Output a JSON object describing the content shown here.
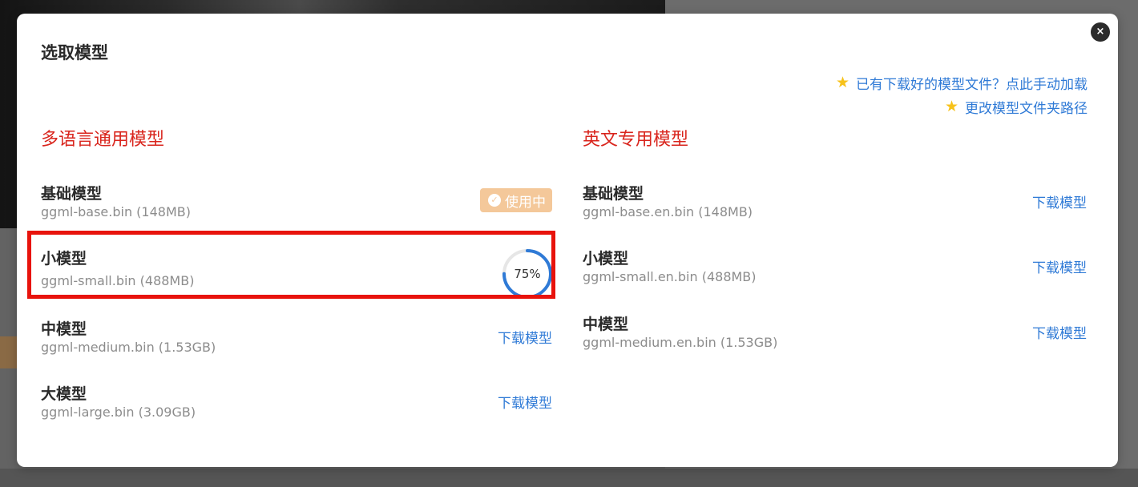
{
  "dialog": {
    "title": "选取模型",
    "close_label": "×"
  },
  "help_links": {
    "manual_load": "已有下载好的模型文件？点此手动加载",
    "change_path": "更改模型文件夹路径",
    "icon": "star-icon"
  },
  "sections": {
    "multilingual": {
      "title": "多语言通用模型",
      "models": [
        {
          "name": "基础模型",
          "file": "ggml-base.bin (148MB)",
          "status": "in_use",
          "action_label": "使用中"
        },
        {
          "name": "小模型",
          "file": "ggml-small.bin (488MB)",
          "status": "downloading",
          "progress": 75,
          "progress_label": "75%"
        },
        {
          "name": "中模型",
          "file": "ggml-medium.bin (1.53GB)",
          "status": "available",
          "action_label": "下载模型"
        },
        {
          "name": "大模型",
          "file": "ggml-large.bin (3.09GB)",
          "status": "available",
          "action_label": "下载模型"
        }
      ]
    },
    "english": {
      "title": "英文专用模型",
      "models": [
        {
          "name": "基础模型",
          "file": "ggml-base.en.bin (148MB)",
          "status": "available",
          "action_label": "下载模型"
        },
        {
          "name": "小模型",
          "file": "ggml-small.en.bin (488MB)",
          "status": "available",
          "action_label": "下载模型"
        },
        {
          "name": "中模型",
          "file": "ggml-medium.en.bin (1.53GB)",
          "status": "available",
          "action_label": "下载模型"
        }
      ]
    }
  },
  "colors": {
    "accent_red": "#d9251d",
    "link_blue": "#2f7ad6",
    "badge_orange": "#f4c89a",
    "progress_blue": "#2f7ad6",
    "highlight_red": "#e8130c"
  }
}
